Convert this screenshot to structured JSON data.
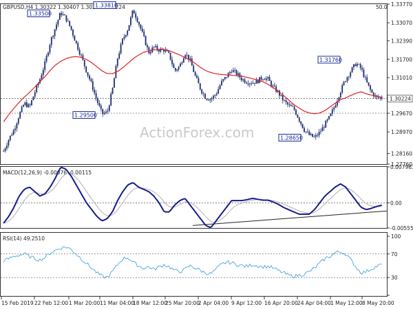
{
  "header": {
    "symbol_info": "GBPUSD,H4  1.30322 1.30407 1.30216 1.30224",
    "corner_value": "50.0"
  },
  "watermark": "ActionForex.com",
  "colors": {
    "candle": "#1a2a6e",
    "ma": "#e02020",
    "macd": "#141a8c",
    "signal": "#b0b0b0",
    "rsi": "#3399dd",
    "annotation": "#1a2a9a"
  },
  "chart_data": [
    {
      "type": "candlestick",
      "title": "GBPUSD,H4  1.30322 1.30407 1.30216 1.30224",
      "y_ticks": [
        "1.33770",
        "1.33070",
        "1.32390",
        "1.31700",
        "1.31010",
        "1.30224",
        "1.29670",
        "1.28970",
        "1.28160",
        "1.27760"
      ],
      "ylim": [
        1.2776,
        1.3377
      ],
      "grid": "horizontal dashed at 1.29670 and 1.30224",
      "annotations": [
        {
          "label": "1.33500",
          "value": 1.335
        },
        {
          "label": "1.33810",
          "value": 1.3381
        },
        {
          "label": "1.29500",
          "value": 1.295
        },
        {
          "label": "1.31760",
          "value": 1.3176
        },
        {
          "label": "1.28650",
          "value": 1.2865
        }
      ],
      "last_price": "1.30224",
      "support_level": "1.29670",
      "close_path": [
        1.2825,
        1.287,
        1.2905,
        1.296,
        1.3005,
        1.299,
        1.3045,
        1.3095,
        1.3155,
        1.3235,
        1.329,
        1.3345,
        1.3325,
        1.3285,
        1.323,
        1.318,
        1.3125,
        1.3075,
        1.3015,
        1.2965,
        1.297,
        1.3055,
        1.3175,
        1.3245,
        1.3285,
        1.3355,
        1.331,
        1.3255,
        1.3195,
        1.3215,
        1.3205,
        1.3205,
        1.3185,
        1.3125,
        1.3145,
        1.3195,
        1.3165,
        1.3105,
        1.3058,
        1.3025,
        1.302,
        1.304,
        1.3082,
        1.3105,
        1.313,
        1.3115,
        1.3095,
        1.3085,
        1.3082,
        1.3088,
        1.3102,
        1.3095,
        1.3065,
        1.3045,
        1.3015,
        1.2995,
        1.2985,
        1.2945,
        1.2905,
        1.2885,
        1.2875,
        1.2895,
        1.2925,
        1.2955,
        1.3,
        1.305,
        1.3095,
        1.3125,
        1.3155,
        1.3135,
        1.3085,
        1.3045,
        1.3025,
        1.3025
      ],
      "ma_path": [
        1.2935,
        1.2962,
        1.2986,
        1.3008,
        1.3028,
        1.3045,
        1.3065,
        1.3085,
        1.3105,
        1.3128,
        1.3148,
        1.3162,
        1.3172,
        1.3178,
        1.318,
        1.3177,
        1.3169,
        1.3157,
        1.3142,
        1.3126,
        1.3116,
        1.3116,
        1.3124,
        1.3138,
        1.3155,
        1.3172,
        1.3185,
        1.3196,
        1.3201,
        1.3205,
        1.3206,
        1.3206,
        1.3202,
        1.3194,
        1.3186,
        1.3176,
        1.3167,
        1.3154,
        1.3139,
        1.3127,
        1.312,
        1.3115,
        1.3113,
        1.3111,
        1.311,
        1.3108,
        1.3106,
        1.3102,
        1.3097,
        1.3092,
        1.3086,
        1.3076,
        1.3064,
        1.305,
        1.3034,
        1.3017,
        1.3,
        1.2987,
        1.2975,
        1.2968,
        1.2965,
        1.2968,
        1.2977,
        1.2991,
        1.3005,
        1.3018,
        1.3025,
        1.3034,
        1.3042,
        1.3048,
        1.304,
        1.3035,
        1.303,
        1.3028
      ]
    },
    {
      "type": "line",
      "title": "MACD(12,26,9) -0.00076 -0.00115",
      "y_ticks": [
        "0.007963",
        "0.00",
        "-0.005559"
      ],
      "ylim": [
        -0.005559,
        0.007963
      ],
      "series": [
        {
          "name": "MACD",
          "values": [
            -0.0045,
            -0.003,
            -0.001,
            0.0015,
            0.003,
            0.0035,
            0.0025,
            0.0015,
            0.002,
            0.0035,
            0.0055,
            0.0079,
            0.0075,
            0.006,
            0.004,
            0.002,
            0.0,
            -0.0015,
            -0.003,
            -0.004,
            -0.0035,
            -0.002,
            0.0005,
            0.0025,
            0.004,
            0.0045,
            0.0035,
            0.003,
            0.0025,
            0.0015,
            0.0,
            -0.002,
            -0.002,
            -0.0005,
            0.0005,
            0.001,
            -0.0005,
            -0.002,
            -0.0035,
            -0.005,
            -0.0055,
            -0.004,
            -0.0025,
            -0.001,
            0.0005,
            0.0005,
            0.0005,
            0.0007,
            0.001,
            0.0008,
            0.0006,
            0.0006,
            0.0002,
            -0.0003,
            -0.001,
            -0.0015,
            -0.002,
            -0.0025,
            -0.0025,
            -0.0025,
            -0.0015,
            0.0,
            0.0015,
            0.0025,
            0.0035,
            0.0042,
            0.0035,
            0.002,
            0.0005,
            -0.001,
            -0.0015,
            -0.0012,
            -0.0008,
            -0.0005
          ]
        }
      ],
      "trendline": [
        -0.005,
        -0.0018
      ]
    },
    {
      "type": "line",
      "title": "RSI(14) 49.2510",
      "y_ticks": [
        "100",
        "70",
        "30",
        "0"
      ],
      "ylim": [
        0,
        100
      ],
      "levels": [
        70,
        30
      ],
      "series": [
        {
          "name": "RSI",
          "values": [
            58,
            62,
            66,
            68,
            70,
            66,
            62,
            60,
            64,
            72,
            76,
            80,
            82,
            78,
            70,
            62,
            54,
            46,
            38,
            32,
            30,
            40,
            52,
            62,
            64,
            56,
            50,
            46,
            48,
            44,
            48,
            52,
            48,
            42,
            40,
            44,
            50,
            46,
            42,
            38,
            36,
            44,
            52,
            56,
            55,
            52,
            50,
            49,
            52,
            50,
            48,
            49,
            46,
            42,
            38,
            34,
            32,
            34,
            36,
            40,
            46,
            54,
            62,
            66,
            72,
            74,
            70,
            60,
            48,
            38,
            40,
            45,
            49,
            52
          ]
        }
      ]
    }
  ],
  "x_axis_labels": [
    "15 Feb 2019",
    "22 Feb 12:00",
    "1 Mar 20:00",
    "11 Mar 04:00",
    "18 Mar 12:00",
    "25 Mar 20:00",
    "2 Apr 04:00",
    "9 Apr 12:00",
    "16 Apr 20:00",
    "24 Apr 04:00",
    "1 May 12:00",
    "8 May 20:00"
  ]
}
